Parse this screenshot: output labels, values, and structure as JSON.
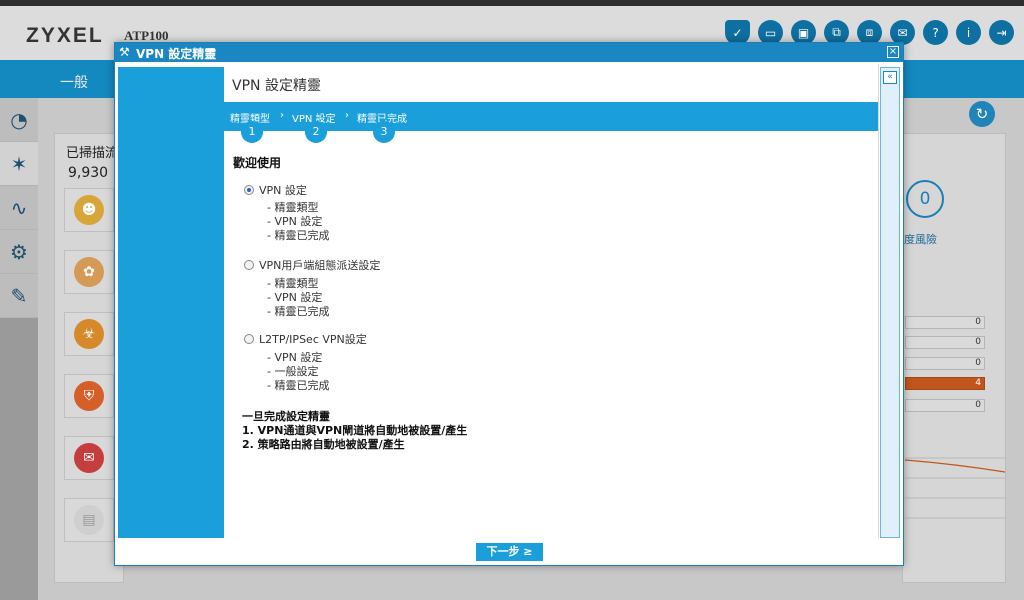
{
  "app": {
    "logo": "ZYXEL",
    "model": "ATP100",
    "nav_general": "一般",
    "header_icons": [
      "shield-check-icon",
      "terminal-icon",
      "cli-icon",
      "window-icon",
      "network-icon",
      "chat-icon",
      "help-icon",
      "info-icon",
      "logout-icon"
    ]
  },
  "background": {
    "scan_title": "已掃描流",
    "scan_count": "9,930",
    "risk_value": "0",
    "risk_label": "度風險",
    "stats": [
      "0",
      "0",
      "0",
      "4",
      "0"
    ],
    "accent_color": "#1a9fdb"
  },
  "modal": {
    "title": "VPN 設定精靈",
    "heading": "VPN 設定精靈",
    "steps": [
      {
        "label": "精靈類型",
        "num": "1"
      },
      {
        "label": "VPN 設定",
        "num": "2"
      },
      {
        "label": "精靈已完成",
        "num": "3"
      }
    ],
    "welcome": "歡迎使用",
    "options": [
      {
        "label": "VPN 設定",
        "checked": true,
        "subs": [
          "- 精靈類型",
          "- VPN 設定",
          "- 精靈已完成"
        ]
      },
      {
        "label": "VPN用戶端組態派送設定",
        "checked": false,
        "subs": [
          "- 精靈類型",
          "- VPN 設定",
          "- 精靈已完成"
        ]
      },
      {
        "label": "L2TP/IPSec VPN設定",
        "checked": false,
        "subs": [
          "- VPN 設定",
          "- 一般設定",
          "- 精靈已完成"
        ]
      }
    ],
    "note_title": "一旦完成設定精靈",
    "note_lines": [
      "1. VPN通道與VPN閘道將自動地被設置/產生",
      "2. 策略路由將自動地被設置/產生"
    ],
    "next_label": "下一步 ≥"
  }
}
